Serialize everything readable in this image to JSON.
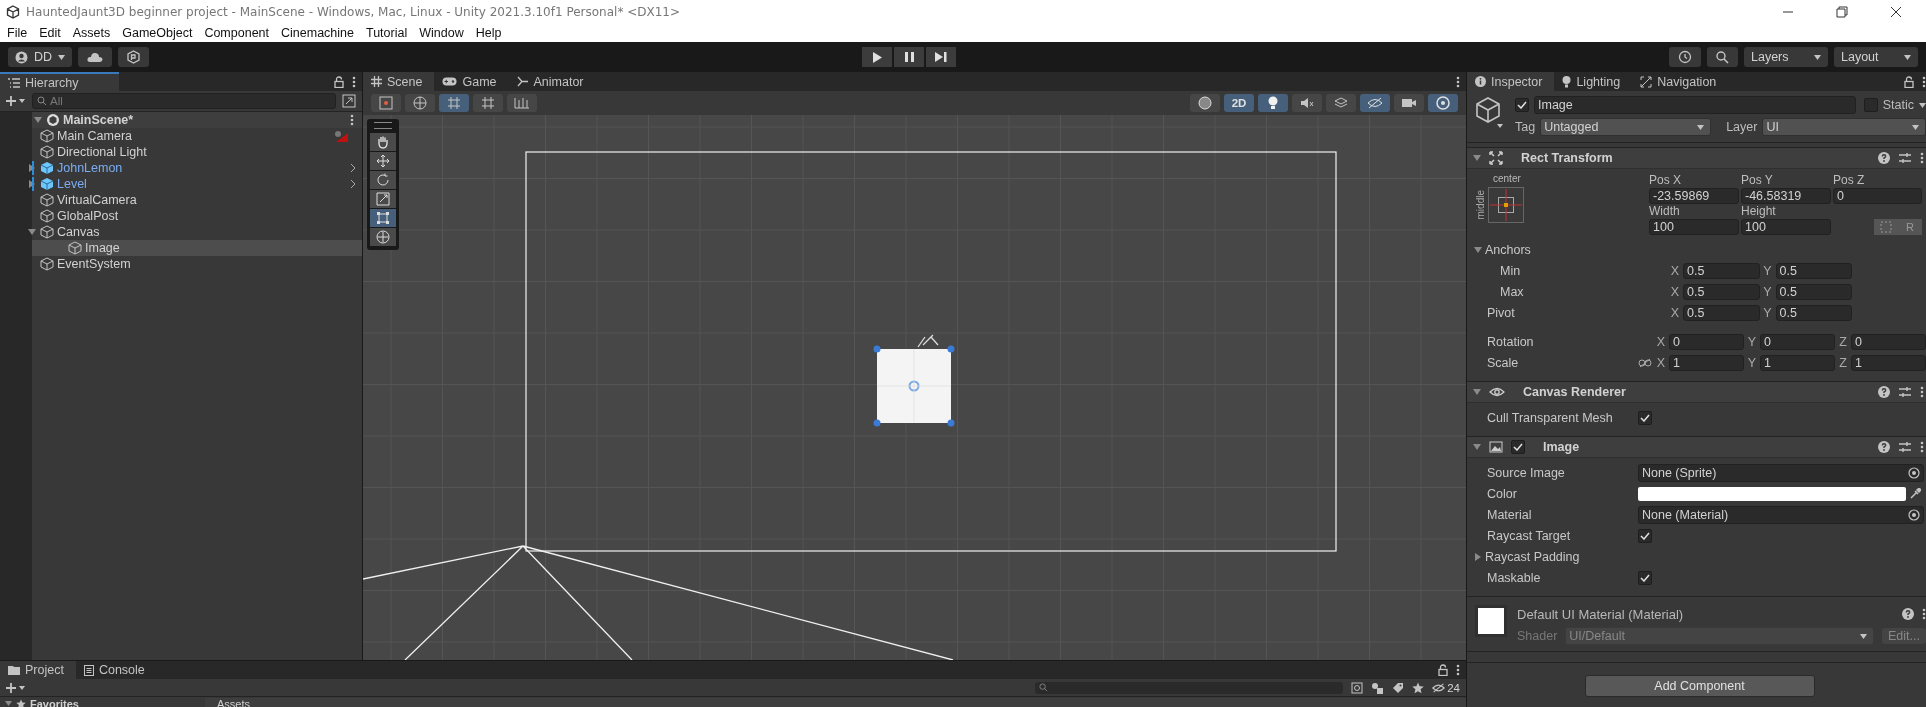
{
  "window": {
    "title": "HauntedJaunt3D beginner project - MainScene - Windows, Mac, Linux - Unity 2021.3.10f1 Personal* <DX11>"
  },
  "menu": [
    "File",
    "Edit",
    "Assets",
    "GameObject",
    "Component",
    "Cinemachine",
    "Tutorial",
    "Window",
    "Help"
  ],
  "toolbar": {
    "account": "DD",
    "layers": "Layers",
    "layout": "Layout"
  },
  "hierarchy": {
    "title": "Hierarchy",
    "search": {
      "placeholder": "All"
    },
    "scene": {
      "name": "MainScene*",
      "expanded": true,
      "children": [
        {
          "name": "Main Camera",
          "kind": "object",
          "selected": false,
          "gizmo_icon": true
        },
        {
          "name": "Directional Light",
          "kind": "object",
          "selected": false,
          "gizmo_icon": false
        },
        {
          "name": "JohnLemon",
          "kind": "prefab",
          "selected": false,
          "gizmo_icon": false,
          "expanded": false
        },
        {
          "name": "Level",
          "kind": "prefab",
          "selected": false,
          "gizmo_icon": false,
          "expanded": false
        },
        {
          "name": "VirtualCamera",
          "kind": "object",
          "selected": false,
          "gizmo_icon": false
        },
        {
          "name": "GlobalPost",
          "kind": "object",
          "selected": false,
          "gizmo_icon": false
        },
        {
          "name": "Canvas",
          "kind": "object",
          "selected": false,
          "gizmo_icon": false,
          "expanded": true,
          "children": [
            {
              "name": "Image",
              "kind": "object",
              "selected": true,
              "gizmo_icon": false
            }
          ]
        },
        {
          "name": "EventSystem",
          "kind": "object",
          "selected": false,
          "gizmo_icon": false
        }
      ]
    }
  },
  "scene_view": {
    "tabs": [
      {
        "label": "Scene",
        "kind": "scene",
        "selected": true
      },
      {
        "label": "Game",
        "kind": "game",
        "selected": false
      },
      {
        "label": "Animator",
        "kind": "animator",
        "selected": false
      }
    ],
    "left_buttons": [
      {
        "kind": "tool-handle",
        "on": false
      },
      {
        "kind": "global",
        "on": false
      },
      {
        "kind": "grid-snap",
        "on": true
      },
      {
        "kind": "increment-snap",
        "on": false
      },
      {
        "kind": "ruler",
        "on": false
      }
    ],
    "right_buttons": [
      {
        "kind": "shading",
        "on": false
      },
      {
        "kind": "mode",
        "label": "2D",
        "on": true
      },
      {
        "kind": "light",
        "on": true
      },
      {
        "kind": "audio",
        "on": false
      },
      {
        "kind": "effects",
        "on": false
      },
      {
        "kind": "visibility",
        "on": true
      },
      {
        "kind": "camera",
        "on": false
      },
      {
        "kind": "gizmos",
        "on": true
      }
    ],
    "tools": [
      {
        "kind": "hand",
        "selected": false
      },
      {
        "kind": "move",
        "selected": false
      },
      {
        "kind": "rotate",
        "selected": false
      },
      {
        "kind": "scale",
        "selected": false
      },
      {
        "kind": "rect",
        "selected": true
      },
      {
        "kind": "transform",
        "selected": false
      }
    ]
  },
  "inspector": {
    "tabs": [
      {
        "label": "Inspector",
        "kind": "info",
        "selected": true
      },
      {
        "label": "Lighting",
        "kind": "bulb",
        "selected": false
      },
      {
        "label": "Navigation",
        "kind": "nav",
        "selected": false
      }
    ],
    "object": {
      "active": true,
      "name": "Image",
      "static_label": "Static",
      "static": false,
      "tag_label": "Tag",
      "tag": "Untagged",
      "layer_label": "Layer",
      "layer": "UI"
    },
    "rect_transform": {
      "title": "Rect Transform",
      "expanded": true,
      "anchor_h": "center",
      "anchor_v": "middle",
      "position": [
        {
          "label": "Pos X",
          "value": "-23.59869"
        },
        {
          "label": "Pos Y",
          "value": "-46.58319"
        },
        {
          "label": "Pos Z",
          "value": "0"
        }
      ],
      "size": [
        {
          "label": "Width",
          "value": "100"
        },
        {
          "label": "Height",
          "value": "100"
        }
      ],
      "raw_button": "R",
      "anchors": {
        "label": "Anchors",
        "expanded": true,
        "rows": [
          {
            "label": "Min",
            "fields": [
              {
                "axis": "X",
                "value": "0.5"
              },
              {
                "axis": "Y",
                "value": "0.5"
              }
            ]
          },
          {
            "label": "Max",
            "fields": [
              {
                "axis": "X",
                "value": "0.5"
              },
              {
                "axis": "Y",
                "value": "0.5"
              }
            ]
          }
        ]
      },
      "pivot": {
        "label": "Pivot",
        "fields": [
          {
            "axis": "X",
            "value": "0.5"
          },
          {
            "axis": "Y",
            "value": "0.5"
          }
        ]
      },
      "rotation": {
        "label": "Rotation",
        "fields": [
          {
            "axis": "X",
            "value": "0"
          },
          {
            "axis": "Y",
            "value": "0"
          },
          {
            "axis": "Z",
            "value": "0"
          }
        ]
      },
      "scale": {
        "label": "Scale",
        "constrained": false,
        "fields": [
          {
            "axis": "X",
            "value": "1"
          },
          {
            "axis": "Y",
            "value": "1"
          },
          {
            "axis": "Z",
            "value": "1"
          }
        ]
      }
    },
    "canvas_renderer": {
      "title": "Canvas Renderer",
      "expanded": true,
      "cull": {
        "label": "Cull Transparent Mesh",
        "checked": true
      }
    },
    "image": {
      "title": "Image",
      "enabled": true,
      "expanded": true,
      "fields": [
        {
          "kind": "object",
          "label": "Source Image",
          "value": "None (Sprite)"
        },
        {
          "kind": "color",
          "label": "Color",
          "color": "#ffffff"
        },
        {
          "kind": "object",
          "label": "Material",
          "value": "None (Material)"
        },
        {
          "kind": "toggle",
          "label": "Raycast Target",
          "checked": true
        },
        {
          "kind": "foldout",
          "label": "Raycast Padding",
          "expanded": false
        },
        {
          "kind": "toggle",
          "label": "Maskable",
          "checked": true
        }
      ]
    },
    "material": {
      "name": "Default UI Material (Material)",
      "shader_label": "Shader",
      "shader": "UI/Default",
      "edit": "Edit..."
    },
    "add_component": "Add Component"
  },
  "project": {
    "tabs": [
      {
        "label": "Project",
        "kind": "folder",
        "selected": true
      },
      {
        "label": "Console",
        "kind": "console",
        "selected": false
      }
    ],
    "hidden_count": "24",
    "favorites": "Favorites",
    "assets": "Assets"
  }
}
